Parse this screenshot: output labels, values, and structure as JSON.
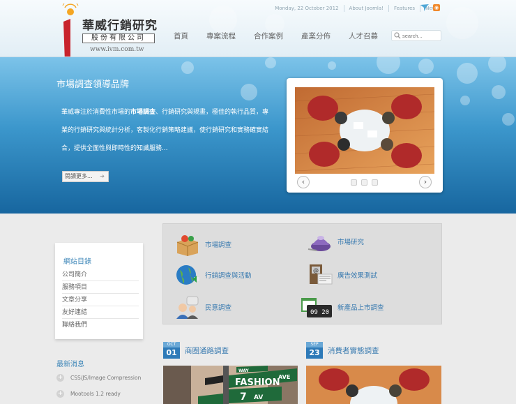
{
  "topbar": {
    "date": "Monday, 22 October 2012",
    "link1": "About Joomla!",
    "link2": "Features",
    "link3": "News"
  },
  "brand": {
    "name": "華威行銷研究",
    "sub": "股份有限公司",
    "url": "www.ivm.com.tw"
  },
  "nav": {
    "items": [
      "首頁",
      "專案流程",
      "合作案例",
      "產業分佈",
      "人才召募"
    ]
  },
  "search": {
    "placeholder": "search..."
  },
  "hero": {
    "title": "市場調查領導品牌",
    "text_pre": "華威專注於消費性市場的",
    "text_strong": "市場調查",
    "text_post": "、行銷研究與規畫，極佳的執行品質，專業的行銷研究與統計分析，客製化行銷策略建議，使行銷研究和實務確實結合，提供全面性與即時性的知識服務...",
    "more": "閱讀更多..."
  },
  "sidebar": {
    "title": "網站目錄",
    "items": [
      "公司簡介",
      "服務項目",
      "文章分享",
      "友好連結",
      "聯絡我們"
    ]
  },
  "news": {
    "title": "最新消息",
    "items": [
      "CSS/JS/Image Compression",
      "Mootools 1.2 ready"
    ]
  },
  "services": {
    "items": [
      "市場調查",
      "市場研究",
      "行銷調查與活動",
      "廣告效果測試",
      "民意調查",
      "新產品上市調查"
    ],
    "clock": "09 20"
  },
  "posts": [
    {
      "month": "OCT",
      "day": "01",
      "title": "商圈通路調查",
      "sign1": "FASHION",
      "sign2": "AVE",
      "sign3": "7",
      "sign4": "AV",
      "sign5": "WAY"
    },
    {
      "month": "SEP",
      "day": "23",
      "title": "消費者實態調查"
    }
  ],
  "colors": {
    "accent": "#3a7bb0",
    "hero_top": "#7cc3e9",
    "hero_bottom": "#17669f",
    "logo_red": "#c8232c"
  }
}
